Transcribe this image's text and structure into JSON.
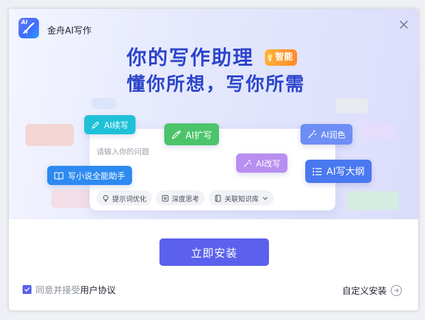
{
  "app": {
    "title": "金舟AI写作",
    "logo_text": "AI"
  },
  "hero": {
    "headline_line1": "你的写作助理",
    "badge": "智能",
    "headline_line2": "懂你所想，写你所需"
  },
  "card": {
    "placeholder": "请输入你的问题",
    "chips": [
      "提示词优化",
      "深度思考",
      "关联知识库"
    ]
  },
  "tags": {
    "continue": "AI续写",
    "expand": "AI扩写",
    "polish": "AI润色",
    "rewrite": "AI改写",
    "outline": "AI写大纲",
    "novel": "写小说全能助手"
  },
  "footer": {
    "install": "立即安装",
    "agree_text": "同意并接受",
    "agree_link": "用户协议",
    "agree_checked": true,
    "custom_install": "自定义安装"
  },
  "colors": {
    "accent": "#5b61ec",
    "headline": "#2c45c9",
    "tag_continue": "#1fc1d8",
    "tag_expand": "#4cc46a",
    "tag_polish": "#6e8ef5",
    "tag_rewrite": "#b88ef0",
    "tag_outline": "#4a78f0",
    "tag_novel": "#2d8af0",
    "badge": "#ff9a30"
  }
}
